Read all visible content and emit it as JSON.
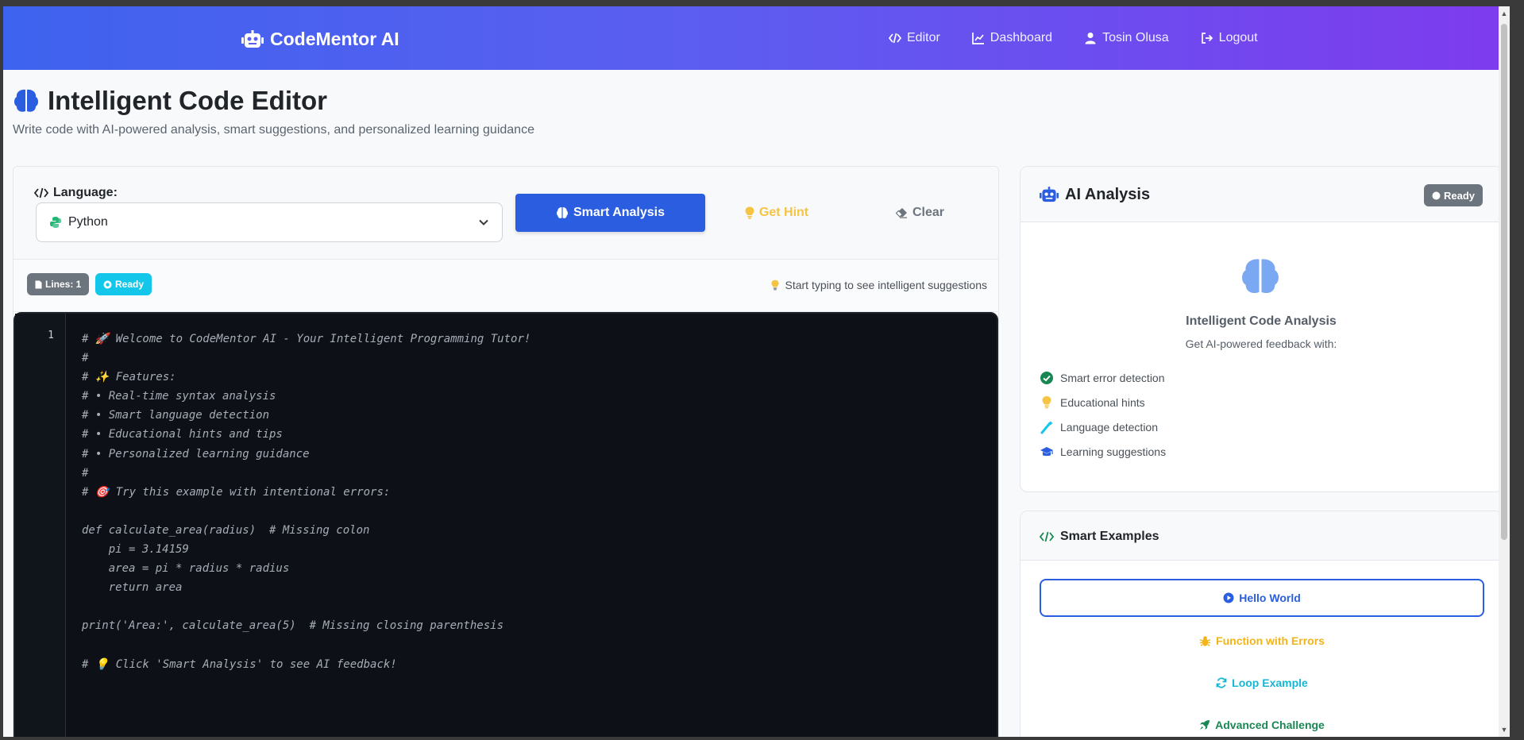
{
  "navbar": {
    "brand": "CodeMentor AI",
    "links": [
      {
        "label": "Editor",
        "icon": "code-icon"
      },
      {
        "label": "Dashboard",
        "icon": "chart-line-icon"
      },
      {
        "label": "Tosin Olusa",
        "icon": "user-icon"
      },
      {
        "label": "Logout",
        "icon": "logout-icon"
      }
    ]
  },
  "header": {
    "title": "Intelligent Code Editor",
    "subtitle": "Write code with AI-powered analysis, smart suggestions, and personalized learning guidance"
  },
  "editor": {
    "language_label": "Language:",
    "language_value": "Python",
    "buttons": {
      "analyze": "Smart Analysis",
      "hint": "Get Hint",
      "clear": "Clear"
    },
    "status": {
      "lines": "Lines: 1",
      "ready": "Ready",
      "hint": "Start typing to see intelligent suggestions"
    },
    "line_number": "1",
    "code": "# 🚀 Welcome to CodeMentor AI - Your Intelligent Programming Tutor!\n#\n# ✨ Features:\n# • Real-time syntax analysis\n# • Smart language detection\n# • Educational hints and tips\n# • Personalized learning guidance\n#\n# 🎯 Try this example with intentional errors:\n\ndef calculate_area(radius)  # Missing colon\n    pi = 3.14159\n    area = pi * radius * radius\n    return area\n\nprint('Area:', calculate_area(5)  # Missing closing parenthesis\n\n# 💡 Click 'Smart Analysis' to see AI feedback!"
  },
  "ai_panel": {
    "title": "AI Analysis",
    "badge": "Ready",
    "heading": "Intelligent Code Analysis",
    "subheading": "Get AI-powered feedback with:",
    "features": [
      "Smart error detection",
      "Educational hints",
      "Language detection",
      "Learning suggestions"
    ]
  },
  "examples": {
    "title": "Smart Examples",
    "items": [
      "Hello World",
      "Function with Errors",
      "Loop Example",
      "Advanced Challenge"
    ]
  },
  "colors": {
    "primary": "#2a5ddf",
    "warning": "#f6c443",
    "info": "#14c6ea",
    "success": "#198754"
  }
}
